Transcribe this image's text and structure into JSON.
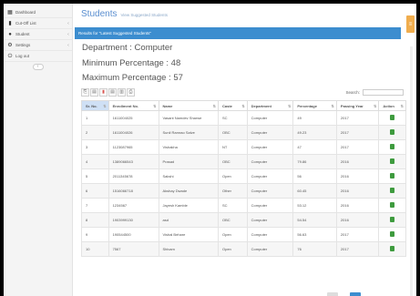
{
  "sidebar": {
    "items": [
      {
        "icon": "dashboard-icon",
        "glyph": "▦",
        "label": "Dashboard",
        "arrow": ""
      },
      {
        "icon": "bar-chart-icon",
        "glyph": "▮",
        "label": "Cut-Off List",
        "arrow": "‹"
      },
      {
        "icon": "user-icon",
        "glyph": "●",
        "label": "Student",
        "arrow": "‹"
      },
      {
        "icon": "gear-icon",
        "glyph": "⚙",
        "label": "Settings",
        "arrow": "‹"
      },
      {
        "icon": "power-icon",
        "glyph": "⏻",
        "label": "Log out",
        "arrow": ""
      }
    ],
    "collapse_glyph": "‹"
  },
  "header": {
    "title": "Students",
    "subtitle": "View Suggested Students"
  },
  "banner": "Results for \"Latest Suggested Students\"",
  "info": {
    "department": "Department : Computer",
    "min_pct": "Minimum Percentage : 48",
    "max_pct": "Maximum Percentage : 57"
  },
  "toolbar": {
    "buttons": [
      {
        "name": "copy-icon",
        "glyph": "⎘"
      },
      {
        "name": "csv-icon",
        "glyph": "▤"
      },
      {
        "name": "pdf-icon",
        "glyph": "▮"
      },
      {
        "name": "excel-icon",
        "glyph": "▤"
      },
      {
        "name": "columns-icon",
        "glyph": "▥"
      },
      {
        "name": "print-icon",
        "glyph": "⎙"
      }
    ],
    "search_label": "Search:"
  },
  "table": {
    "headers": [
      "Sr. No.",
      "Enrollment No.",
      "Name",
      "Caste",
      "Department",
      "Percentage",
      "Passing Year",
      "Action"
    ],
    "rows": [
      [
        "1",
        "1611004025",
        "Vasant Namdev Sharwe",
        "SC",
        "Computer",
        "49",
        "2017"
      ],
      [
        "2",
        "1611004026",
        "Sunil Ramrao Salve",
        "OBC",
        "Computer",
        "49.23",
        "2017"
      ],
      [
        "3",
        "1123087965",
        "Vishakha",
        "NT",
        "Computer",
        "47",
        "2017"
      ],
      [
        "4",
        "1389066543",
        "Prasad",
        "OBC",
        "Computer",
        "79.86",
        "2016"
      ],
      [
        "5",
        "2011345678",
        "Sakshi",
        "Open",
        "Computer",
        "56",
        "2016"
      ],
      [
        "6",
        "1516066718",
        "Akshay Dwade",
        "Other",
        "Computer",
        "60.45",
        "2016"
      ],
      [
        "7",
        "1234567",
        "Jayesh Kamble",
        "SC",
        "Computer",
        "53.12",
        "2016"
      ],
      [
        "8",
        "1903999130",
        "asd",
        "OBC",
        "Computer",
        "54.54",
        "2016"
      ],
      [
        "9",
        "190544500",
        "Vishal Behare",
        "Open",
        "Computer",
        "56.63",
        "2017"
      ],
      [
        "10",
        "7567",
        "Shivam",
        "Open",
        "Computer",
        "76",
        "2017"
      ]
    ]
  }
}
